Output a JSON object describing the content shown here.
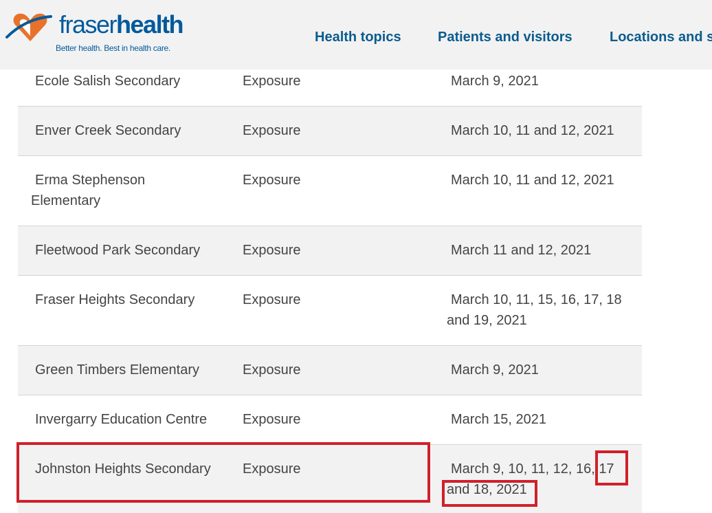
{
  "header": {
    "logo": {
      "word_light": "fraser",
      "word_bold": "health",
      "tagline": "Better health. Best in health care."
    },
    "nav": [
      "Health topics",
      "Patients and visitors",
      "Locations and s"
    ]
  },
  "colors": {
    "brand_blue": "#005a9c",
    "brand_orange": "#e8722c",
    "highlight_red": "#d0202b"
  },
  "table": {
    "rows": [
      {
        "school": "Ecole Salish Secondary",
        "type": "Exposure",
        "dates": "March 9, 2021"
      },
      {
        "school": "Enver Creek Secondary",
        "type": "Exposure",
        "dates": "March 10, 11 and 12, 2021"
      },
      {
        "school": "Erma Stephenson Elementary",
        "type": "Exposure",
        "dates": "March 10, 11 and 12, 2021"
      },
      {
        "school": "Fleetwood Park Secondary",
        "type": "Exposure",
        "dates": "March 11 and 12, 2021"
      },
      {
        "school": "Fraser Heights Secondary",
        "type": "Exposure",
        "dates": "March 10, 11, 15, 16, 17, 18 and 19, 2021"
      },
      {
        "school": "Green Timbers Elementary",
        "type": "Exposure",
        "dates": "March 9, 2021"
      },
      {
        "school": "Invergarry Education Centre",
        "type": "Exposure",
        "dates": "March 15, 2021"
      },
      {
        "school": "Johnston Heights Secondary",
        "type": "Exposure",
        "dates": "March 9, 10, 11, 12, 16, 17 and 18, 2021"
      }
    ]
  }
}
